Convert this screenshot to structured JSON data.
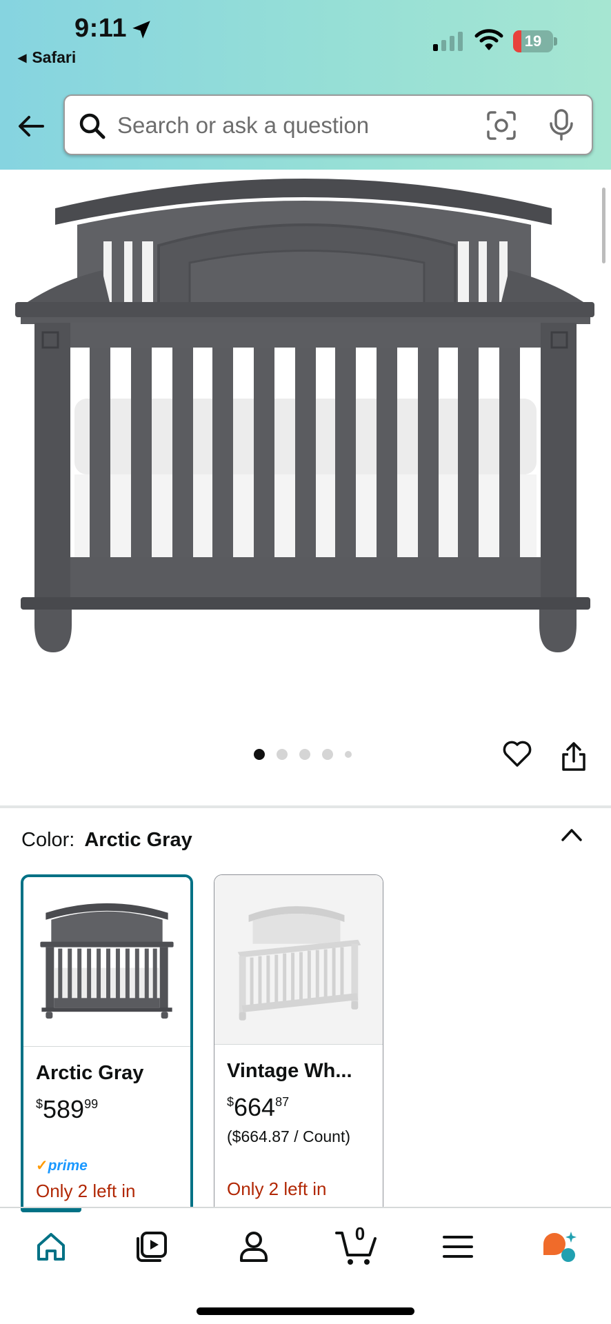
{
  "status_bar": {
    "time": "9:11",
    "back_app": "Safari",
    "battery": "19"
  },
  "search": {
    "placeholder": "Search or ask a question"
  },
  "carousel": {
    "image_count": 5,
    "active_index": 0
  },
  "color": {
    "label": "Color:",
    "selected": "Arctic Gray"
  },
  "swatches": [
    {
      "name": "Arctic Gray",
      "currency": "$",
      "price_whole": "589",
      "price_fraction": "99",
      "unit_price": "",
      "prime": "prime",
      "stock": "Only 2 left in",
      "selected": true
    },
    {
      "name": "Vintage Wh...",
      "currency": "$",
      "price_whole": "664",
      "price_fraction": "87",
      "unit_price": "($664.87 / Count)",
      "prime": "",
      "stock": "Only 2 left in",
      "selected": false
    }
  ],
  "nav": {
    "items": [
      "home-icon",
      "video-icon",
      "account-icon",
      "cart-icon",
      "menu-icon",
      "rufus-icon"
    ],
    "cart_count": "0"
  },
  "colors": {
    "accent": "#007185",
    "stock": "#b12704",
    "prime": "#1a98ff",
    "crib_gray": "#5a5b5f",
    "crib_white": "#e6e6e6"
  }
}
